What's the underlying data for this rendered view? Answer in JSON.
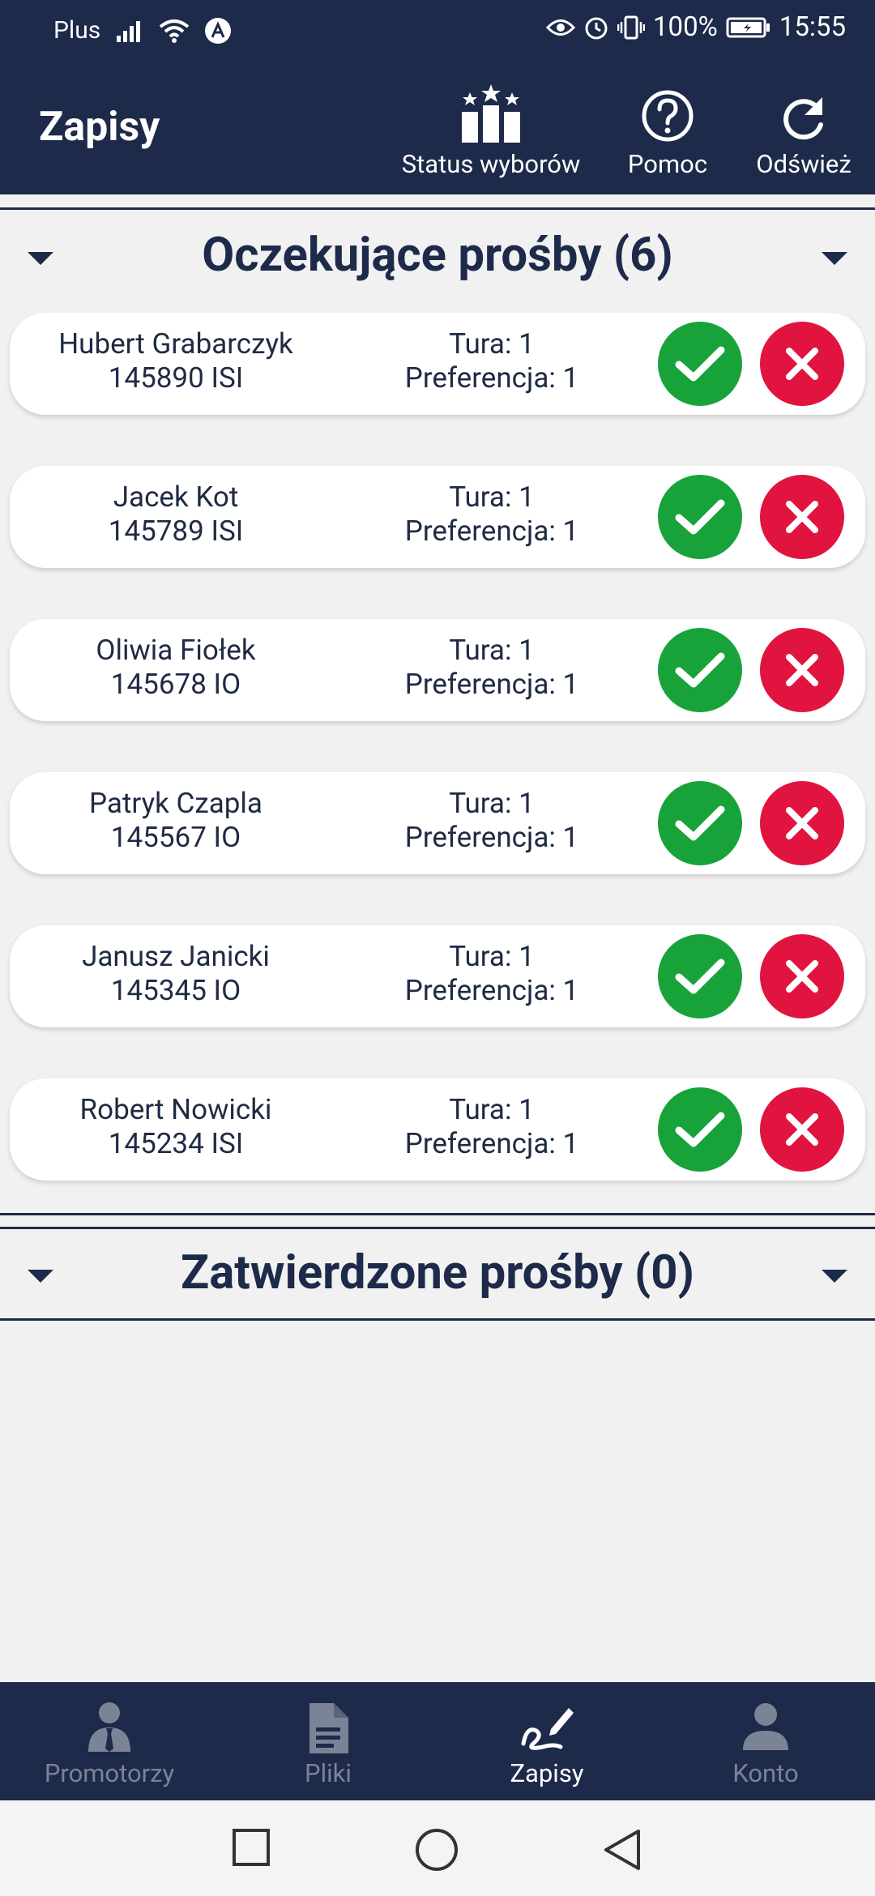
{
  "status_bar": {
    "carrier": "Plus",
    "battery": "100%",
    "time": "15:55"
  },
  "app_bar": {
    "title": "Zapisy",
    "actions": [
      {
        "label": "Status wyborów",
        "icon": "stars-podium-icon"
      },
      {
        "label": "Pomoc",
        "icon": "help-circle-icon"
      },
      {
        "label": "Odśwież",
        "icon": "refresh-icon"
      }
    ]
  },
  "pending": {
    "title": "Oczekujące prośby (6)",
    "requests": [
      {
        "name": "Hubert Grabarczyk",
        "id": "145890 ISI",
        "round": "Tura: 1",
        "preference": "Preferencja: 1"
      },
      {
        "name": "Jacek Kot",
        "id": "145789 ISI",
        "round": "Tura: 1",
        "preference": "Preferencja: 1"
      },
      {
        "name": "Oliwia Fiołek",
        "id": "145678 IO",
        "round": "Tura: 1",
        "preference": "Preferencja: 1"
      },
      {
        "name": "Patryk Czapla",
        "id": "145567 IO",
        "round": "Tura: 1",
        "preference": "Preferencja: 1"
      },
      {
        "name": "Janusz Janicki",
        "id": "145345 IO",
        "round": "Tura: 1",
        "preference": "Preferencja: 1"
      },
      {
        "name": "Robert Nowicki",
        "id": "145234 ISI",
        "round": "Tura: 1",
        "preference": "Preferencja: 1"
      }
    ]
  },
  "approved": {
    "title": "Zatwierdzone prośby (0)"
  },
  "bottom_nav": [
    {
      "label": "Promotorzy",
      "icon": "supervisor-person-icon",
      "active": false
    },
    {
      "label": "Pliki",
      "icon": "document-icon",
      "active": false
    },
    {
      "label": "Zapisy",
      "icon": "signature-pen-icon",
      "active": true
    },
    {
      "label": "Konto",
      "icon": "account-icon",
      "active": false
    }
  ],
  "colors": {
    "primary": "#1e2a4a",
    "accept": "#17a33a",
    "reject": "#e0143f",
    "background": "#f1f1f1",
    "inactive_nav": "#7b8396"
  }
}
